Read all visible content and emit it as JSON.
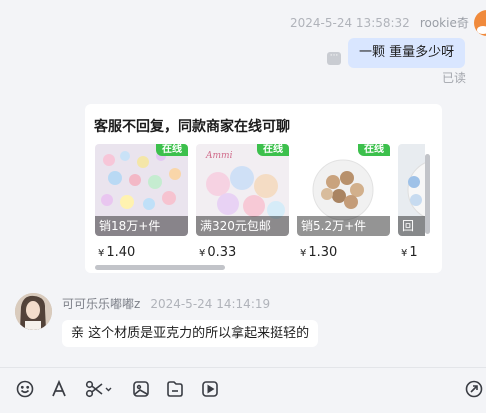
{
  "outgoing": {
    "timestamp": "2024-5-24 13:58:32",
    "sender": "rookie奇",
    "message": "一颗 重量多少呀",
    "read_status": "已读"
  },
  "card": {
    "title": "客服不回复，同款商家在线可聊",
    "online_label": "在线",
    "products": [
      {
        "sales": "销18万+件",
        "currency": "¥",
        "price": "1.40"
      },
      {
        "sales": "满320元包邮",
        "currency": "¥",
        "price": "0.33"
      },
      {
        "sales": "销5.2万+件",
        "currency": "¥",
        "price": "1.30"
      },
      {
        "sales": "回",
        "currency": "¥",
        "price": "1"
      }
    ]
  },
  "incoming": {
    "sender": "可可乐乐嘟嘟z",
    "timestamp": "2024-5-24 14:14:19",
    "message": "亲 这个材质是亚克力的所以拿起来挺轻的"
  },
  "toolbar": {
    "icons": [
      "emoji-icon",
      "font-icon",
      "scissors-icon",
      "image-icon",
      "file-icon",
      "video-icon",
      "send-arrow-icon"
    ]
  }
}
